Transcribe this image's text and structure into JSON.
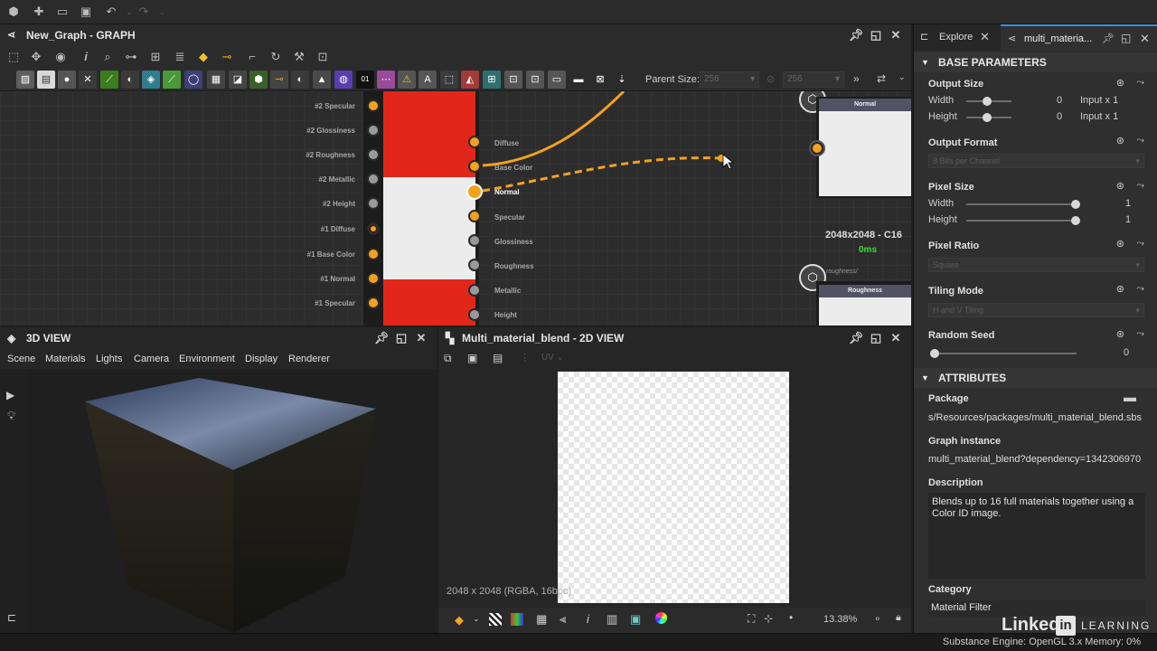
{
  "toolbar_top": {
    "undo_icon": "undo-icon",
    "redo_icon": "redo-icon"
  },
  "graph": {
    "title": "New_Graph - GRAPH",
    "parent_size_label": "Parent Size:",
    "parent_size_value": "256",
    "size_value2": "256",
    "inputs": [
      "#2 Specular",
      "#2 Glossiness",
      "#2 Roughness",
      "#2 Metallic",
      "#2 Height",
      "#1 Diffuse",
      "#1 Base Color",
      "#1 Normal",
      "#1 Specular"
    ],
    "outputs": [
      "Diffuse",
      "Base Color",
      "Normal",
      "Specular",
      "Glossiness",
      "Roughness",
      "Metallic",
      "Height"
    ],
    "node_normal": {
      "title": "Normal",
      "size": "2048x2048 - C16",
      "time": "0ms"
    },
    "node_roughness": {
      "title": "Roughness",
      "subtitle": "roughness/"
    }
  },
  "view3d": {
    "title": "3D VIEW",
    "menu": [
      "Scene",
      "Materials",
      "Lights",
      "Camera",
      "Environment",
      "Display",
      "Renderer"
    ]
  },
  "view2d": {
    "title": "Multi_material_blend - 2D VIEW",
    "uv_label": "UV",
    "resolution": "2048 x 2048 (RGBA, 16bpc)",
    "zoom": "13.38%"
  },
  "right": {
    "tab_explorer": "Explore",
    "tab_active": "multi_materia...",
    "base_params": "BASE PARAMETERS",
    "output_size": {
      "label": "Output Size",
      "width_label": "Width",
      "height_label": "Height",
      "width_value": "0",
      "height_value": "0",
      "width_mode": "Input x 1",
      "height_mode": "Input x 1"
    },
    "output_format": {
      "label": "Output Format",
      "value": "8 Bits per Channel"
    },
    "pixel_size": {
      "label": "Pixel Size",
      "width_label": "Width",
      "height_label": "Height",
      "width_value": "1",
      "height_value": "1"
    },
    "pixel_ratio": {
      "label": "Pixel Ratio",
      "value": "Square"
    },
    "tiling_mode": {
      "label": "Tiling Mode",
      "value": "H and V Tiling"
    },
    "random_seed": {
      "label": "Random Seed",
      "value": "0"
    },
    "attributes": "ATTRIBUTES",
    "package": {
      "label": "Package",
      "value": "s/Resources/packages/multi_material_blend.sbs"
    },
    "graph_instance": {
      "label": "Graph instance",
      "value": "multi_material_blend?dependency=1342306970"
    },
    "description": {
      "label": "Description",
      "value": "Blends up to 16 full materials together using a Color ID image."
    },
    "category": {
      "label": "Category",
      "value": "Material Filter"
    }
  },
  "status": {
    "engine": "Substance Engine: OpenGL 3.x  Memory: 0%"
  },
  "watermark": {
    "brand": "Linked",
    "brand_in": "in",
    "learning": "LEARNING"
  },
  "colors": {
    "accent": "#f3a21d",
    "node_red": "#e3261a",
    "time_green": "#3ddc3d"
  }
}
